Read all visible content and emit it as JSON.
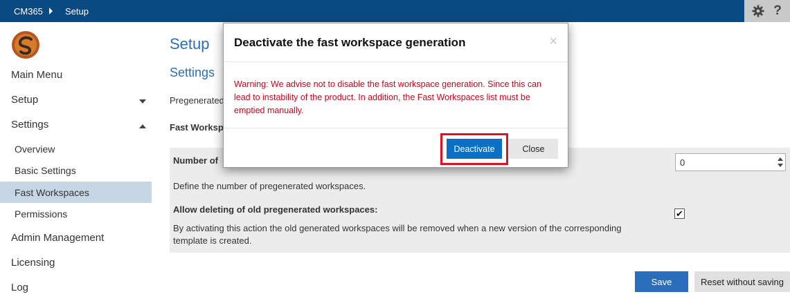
{
  "topbar": {
    "app_name": "CM365",
    "breadcrumb": "Setup",
    "settings_icon": "gear-icon",
    "help_label": "?"
  },
  "sidebar": {
    "items": [
      {
        "label": "Main Menu"
      },
      {
        "label": "Setup"
      },
      {
        "label": "Settings"
      },
      {
        "label": "Overview"
      },
      {
        "label": "Basic Settings"
      },
      {
        "label": "Fast Workspaces"
      },
      {
        "label": "Permissions"
      },
      {
        "label": "Admin Management"
      },
      {
        "label": "Licensing"
      },
      {
        "label": "Log"
      }
    ]
  },
  "main": {
    "page_title": "Setup",
    "section_title": "Settings",
    "pregen_label": "Pregenerated",
    "fastws_heading": "Fast Worksp",
    "number_label": "Number of",
    "number_value": "0",
    "number_help": "Define the number of pregenerated workspaces.",
    "allow_label": "Allow deleting of old pregenerated workspaces:",
    "allow_help_1": "By activating this action the old generated workspaces will be removed when a new version of the corresponding",
    "allow_help_2": "template is created.",
    "allow_checked": "✔",
    "save_label": "Save",
    "reset_label": "Reset without saving"
  },
  "modal": {
    "title": "Deactivate the fast workspace generation",
    "close_symbol": "×",
    "warning_1": "Warning: We advise not to disable the fast workspace generation. Since this can",
    "warning_2": "lead to instability of the product. In addition, the Fast Workspaces list must be",
    "warning_3": "emptied manually.",
    "deactivate_label": "Deactivate",
    "close_label": "Close"
  },
  "colors": {
    "topbar": "#0a4a82",
    "accent": "#2a6ebb",
    "warning": "#d0021b",
    "highlight": "#e0101e"
  }
}
